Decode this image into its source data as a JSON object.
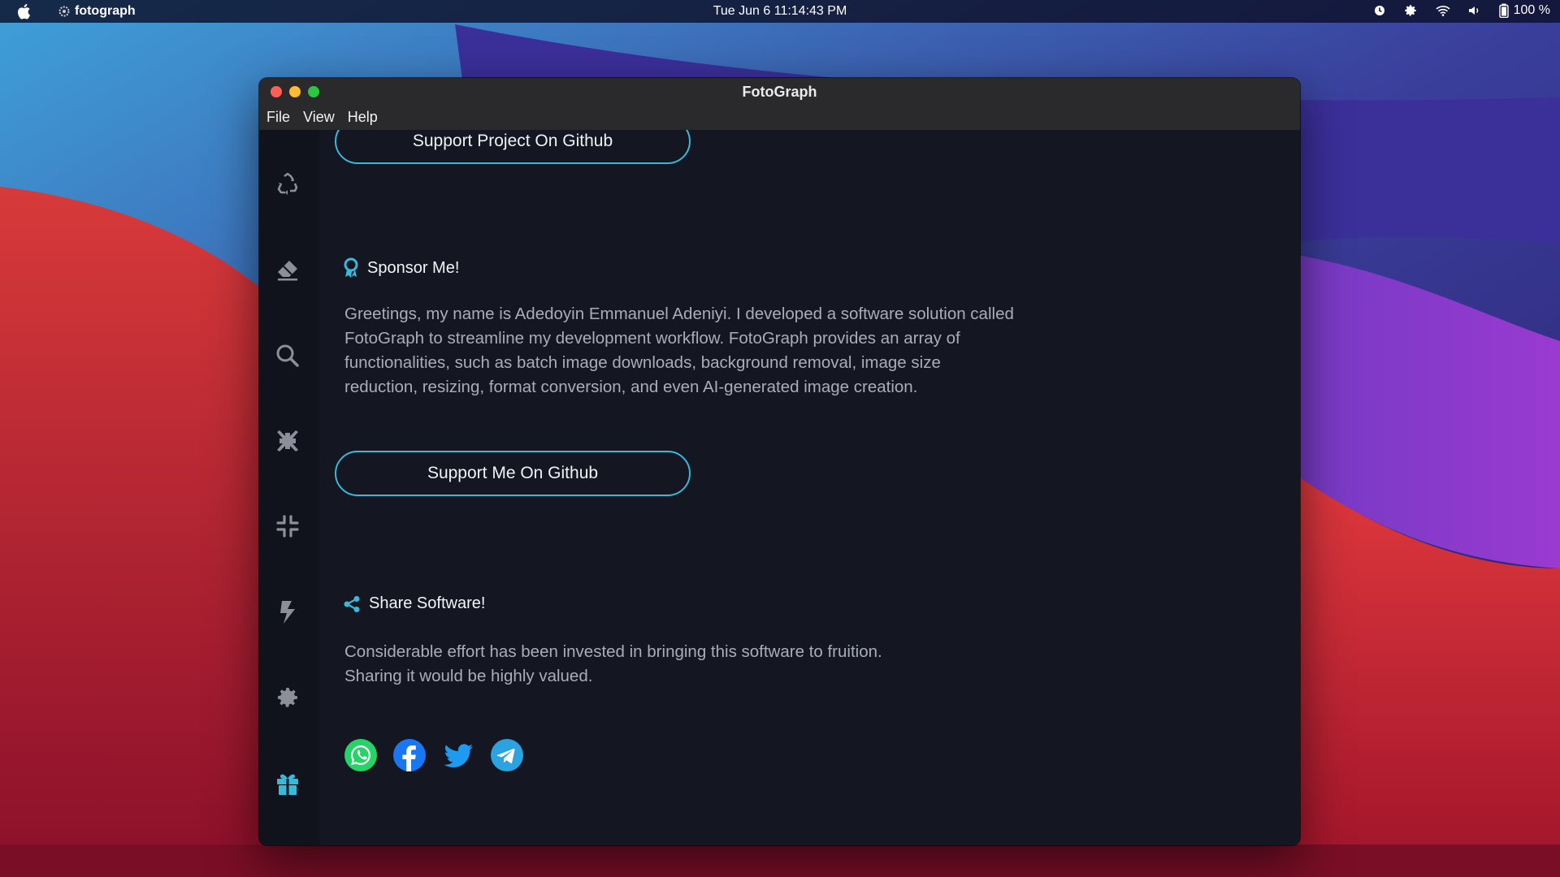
{
  "menubar": {
    "app_name": "fotograph",
    "clock": "Tue Jun 6  11:14:43 PM",
    "battery": "100 %"
  },
  "window": {
    "title": "FotoGraph",
    "menu": [
      "File",
      "View",
      "Help"
    ]
  },
  "sidebar": {
    "items": [
      {
        "icon": "recycle-icon"
      },
      {
        "icon": "eraser-icon"
      },
      {
        "icon": "search-icon"
      },
      {
        "icon": "compress-arrows-icon"
      },
      {
        "icon": "minimize-icon"
      },
      {
        "icon": "bolt-icon"
      },
      {
        "icon": "gear-icon"
      },
      {
        "icon": "gift-icon",
        "active": true
      }
    ]
  },
  "content": {
    "support_project_button": "Support Project On Github",
    "sponsor": {
      "title": "Sponsor Me!",
      "lines": [
        "Greetings, my name is Adedoyin Emmanuel Adeniyi. I developed a software solution called",
        "FotoGraph to streamline my development workflow. FotoGraph provides an array of",
        "functionalities, such as batch image downloads, background removal, image size",
        "reduction, resizing, format conversion, and even AI-generated image creation."
      ],
      "button": "Support Me On Github"
    },
    "share": {
      "title": "Share Software!",
      "lines": [
        "Considerable effort has been invested in bringing this software to fruition.",
        "Sharing it would be highly valued."
      ],
      "networks": [
        "whatsapp-icon",
        "facebook-icon",
        "twitter-icon",
        "telegram-icon"
      ]
    }
  },
  "colors": {
    "accent": "#3ab8d8",
    "window_bg": "#141722",
    "sidebar_bg": "#10131c",
    "titlebar_bg": "#2a2a2c",
    "muted_text": "#a8adb8",
    "whatsapp": "#25d366",
    "facebook": "#1877f2",
    "twitter": "#1d9bf0",
    "telegram": "#2aa3e0"
  }
}
